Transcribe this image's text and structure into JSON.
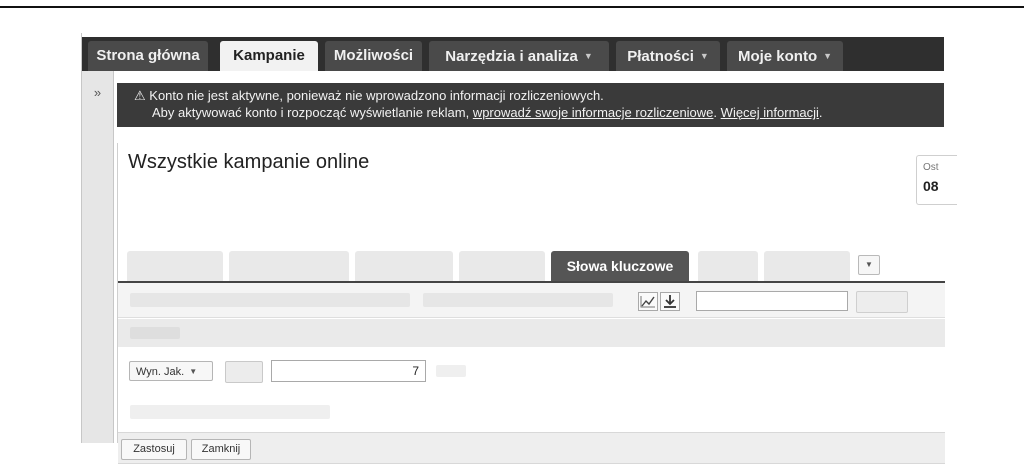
{
  "nav": {
    "tabs": [
      {
        "label": "Strona główna"
      },
      {
        "label": "Kampanie"
      },
      {
        "label": "Możliwości"
      },
      {
        "label": "Narzędzia i analiza"
      },
      {
        "label": "Płatności"
      },
      {
        "label": "Moje konto"
      }
    ],
    "rail_toggle": "»"
  },
  "alert": {
    "icon": "warning-icon",
    "line1": "Konto nie jest aktywne, ponieważ nie wprowadzono informacji rozliczeniowych.",
    "line2_prefix": "Aby aktywować konto i rozpocząć wyświetlanie reklam,",
    "link1": "wprowadź swoje informacje rozliczeniowe",
    "link2": "Więcej informacji",
    "period": "."
  },
  "main": {
    "title": "Wszystkie kampanie online",
    "date_label": "Ost",
    "date_value": "08"
  },
  "subtabs": {
    "active_label": "Słowa kluczowe"
  },
  "toolbar": {
    "chart_icon": "line-chart-icon",
    "download_icon": "download-icon",
    "search_value": ""
  },
  "filter": {
    "metric_label": "Wyn. Jak.",
    "value": "7"
  },
  "actions": {
    "apply": "Zastosuj",
    "close": "Zamknij"
  }
}
